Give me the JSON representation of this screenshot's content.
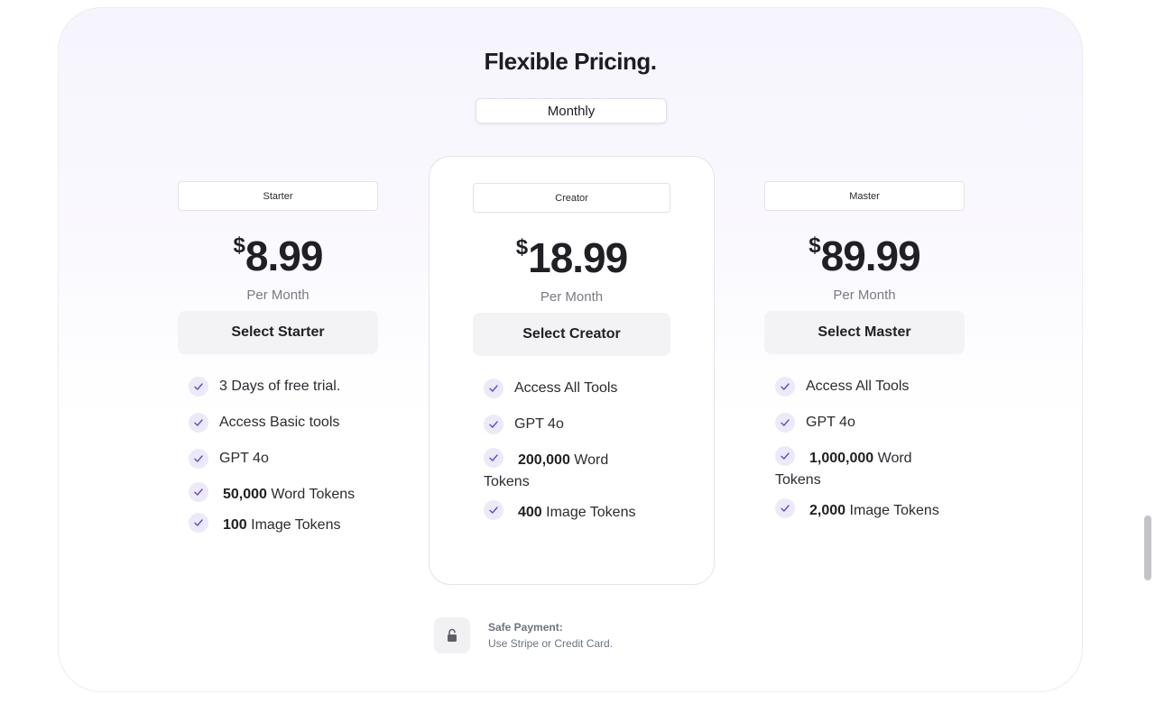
{
  "title": "Flexible Pricing.",
  "billing_toggle": {
    "selected": "Monthly"
  },
  "colors": {
    "accent": "#5b4fc4",
    "check_bg": "#ece9f8",
    "button_bg": "#f3f3f5"
  },
  "plans": [
    {
      "name": "Starter",
      "currency": "$",
      "price": "8.99",
      "period": "Per Month",
      "cta": "Select Starter",
      "features": [
        {
          "bold": "",
          "text": "3 Days of free trial."
        },
        {
          "bold": "",
          "text": "Access Basic tools"
        },
        {
          "bold": "",
          "text": "GPT 4o"
        },
        {
          "bold": "50,000",
          "text": "Word Tokens"
        },
        {
          "bold": "100",
          "text": "Image Tokens"
        }
      ]
    },
    {
      "name": "Creator",
      "currency": "$",
      "price": "18.99",
      "period": "Per Month",
      "cta": "Select Creator",
      "features": [
        {
          "bold": "",
          "text": "Access All Tools"
        },
        {
          "bold": "",
          "text": "GPT 4o"
        },
        {
          "bold": "200,000",
          "text": "Word",
          "text2": "Tokens"
        },
        {
          "bold": "400",
          "text": "Image Tokens"
        }
      ]
    },
    {
      "name": "Master",
      "currency": "$",
      "price": "89.99",
      "period": "Per Month",
      "cta": "Select Master",
      "features": [
        {
          "bold": "",
          "text": "Access All Tools"
        },
        {
          "bold": "",
          "text": "GPT 4o"
        },
        {
          "bold": "1,000,000",
          "text": "Word",
          "text2": "Tokens"
        },
        {
          "bold": "2,000",
          "text": "Image Tokens"
        }
      ]
    }
  ],
  "safe_payment": {
    "title": "Safe Payment:",
    "subtitle": "Use Stripe or Credit Card.",
    "icon": "lock-icon"
  }
}
